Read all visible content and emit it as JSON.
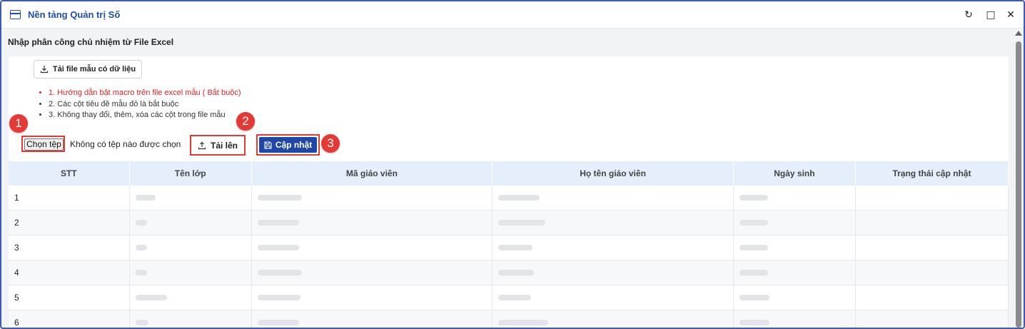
{
  "window": {
    "title": "Nền tảng Quản trị Số",
    "refresh_icon": "↻",
    "maximize_icon": "□",
    "close_icon": "✕"
  },
  "page": {
    "heading": "Nhập phân công chủ nhiệm từ File Excel"
  },
  "toolbar": {
    "download_template_label": "Tải file mẫu có dữ liệu",
    "choose_file_label": "Chọn tệp",
    "no_file_text": "Không có tệp nào được chọn",
    "upload_label": "Tải lên",
    "update_label": "Cập nhật"
  },
  "notes": [
    "1. Hướng dẫn bật macro trên file excel mẫu ( Bắt buộc)",
    "2. Các cột tiêu đề mẫu đỏ là bắt buộc",
    "3. Không thay đổi, thêm, xóa các cột trong file mẫu"
  ],
  "markers": [
    "1",
    "2",
    "3"
  ],
  "table": {
    "columns": [
      "STT",
      "Tên lớp",
      "Mã giáo viên",
      "Họ tên giáo viên",
      "Ngày sinh",
      "Trạng thái cập nhật"
    ],
    "rows": [
      {
        "stt": "1"
      },
      {
        "stt": "2"
      },
      {
        "stt": "3"
      },
      {
        "stt": "4"
      },
      {
        "stt": "5"
      },
      {
        "stt": "6"
      }
    ]
  },
  "colors": {
    "accent": "#1d4fa8",
    "primary_button": "#1f47a8",
    "highlight": "#e53935",
    "warning_text": "#e02020"
  }
}
